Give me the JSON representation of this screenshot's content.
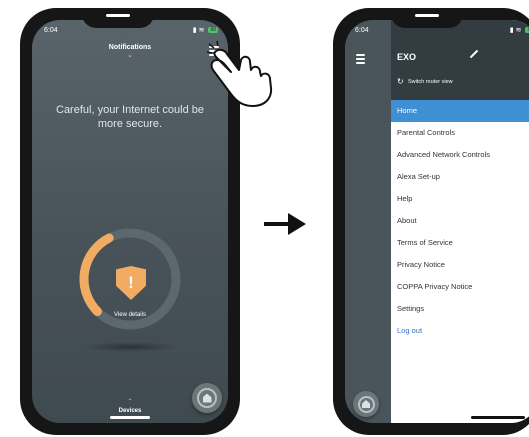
{
  "left_phone": {
    "status_time": "6:04",
    "battery": "88",
    "header_title": "Notifications",
    "headline": "Careful, your Internet could be more secure.",
    "alert_symbol": "!",
    "view_details": "View details",
    "devices_label": "Devices",
    "chevron_down": "⌄",
    "chevron_up": "⌃",
    "gauge_fill_fraction": 0.4,
    "accent_color": "#f2ab62"
  },
  "right_phone": {
    "status_time": "6:04",
    "battery": "88",
    "network_name": "EXO",
    "switch_router_view": "Switch router view",
    "menu_items": [
      "Home",
      "Parental Controls",
      "Advanced Network Controls",
      "Alexa Set-up",
      "Help",
      "About",
      "Terms of Service",
      "Privacy Notice",
      "COPPA Privacy Notice",
      "Settings",
      "Log out"
    ],
    "active_item": "Home",
    "active_color": "#3e8fd4",
    "logout_color": "#2f74c0"
  },
  "icons": {
    "menu": "hamburger-icon",
    "hand": "tap-hand-icon",
    "arrow": "arrow-right-icon",
    "home": "home-icon",
    "edit": "pencil-icon",
    "refresh": "refresh-icon"
  }
}
